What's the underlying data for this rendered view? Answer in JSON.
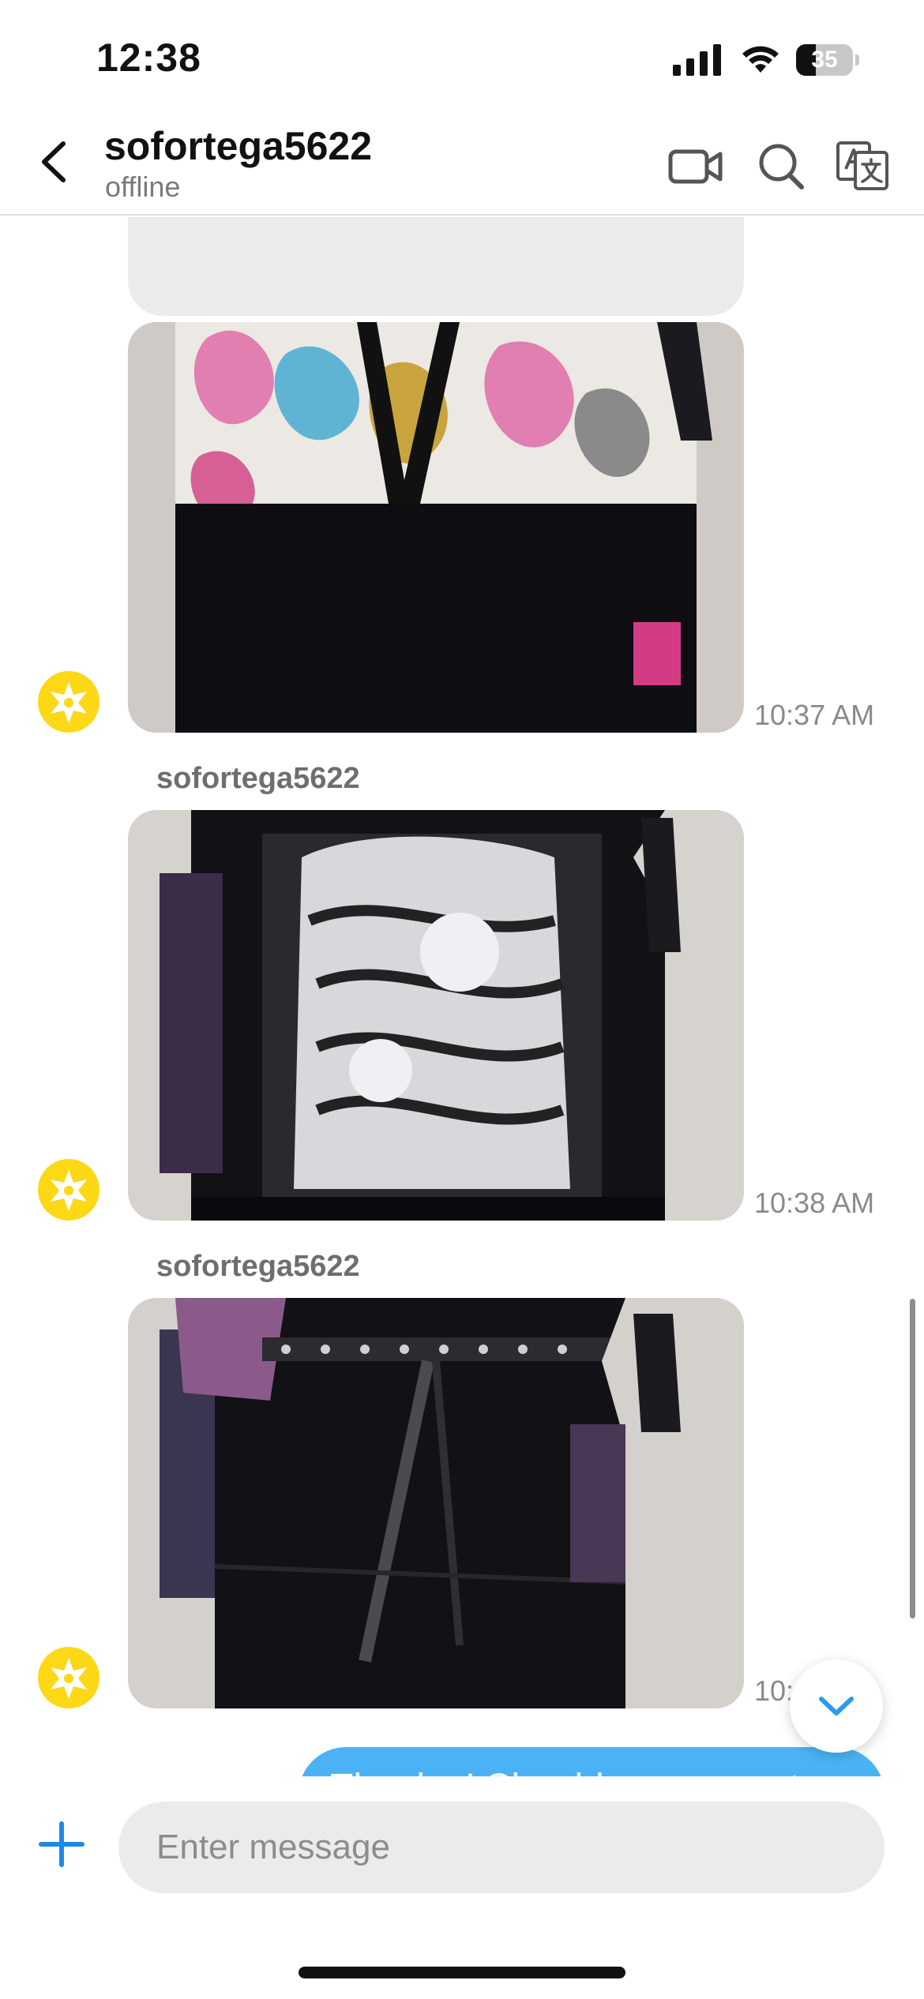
{
  "status_bar": {
    "time": "12:38",
    "battery": "35",
    "battery_level": 0.35
  },
  "header": {
    "title": "sofortega5622",
    "subtitle": "offline"
  },
  "messages": [
    {
      "type": "image",
      "time": "10:37 AM"
    },
    {
      "type": "image",
      "sender": "sofortega5622",
      "time": "10:38 AM"
    },
    {
      "type": "image",
      "sender": "sofortega5622",
      "time": "10:"
    },
    {
      "type": "text",
      "direction": "outgoing",
      "text": "Thanks ! Should we support"
    }
  ],
  "composer": {
    "placeholder": "Enter message"
  },
  "colors": {
    "accent": "#4bb3f5",
    "avatar": "#fcd817",
    "icon_blue": "#1e88e5"
  },
  "icons": [
    "back-icon",
    "video-camera-icon",
    "search-icon",
    "translate-icon",
    "chevron-down-icon",
    "plus-icon"
  ]
}
